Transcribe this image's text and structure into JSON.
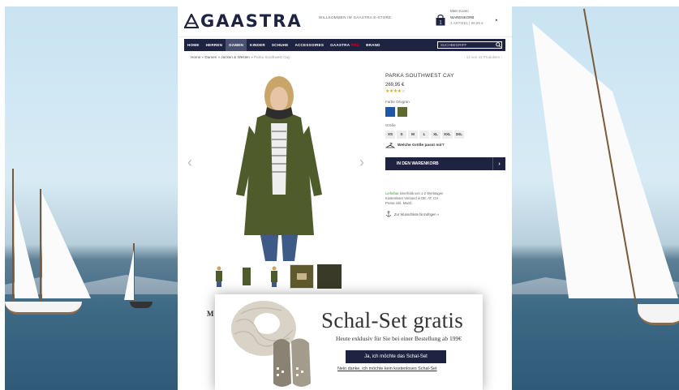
{
  "header": {
    "brand": "GAASTRA",
    "welcome": "WILLKOMMEN IM GAASTRA E-STORE",
    "account": "Mein Konto",
    "cart_title": "WARENKORB",
    "cart_sub": "1 ARTIKEL | 99,95 €"
  },
  "nav": {
    "items": [
      "HOME",
      "HERREN",
      "DAMEN",
      "KINDER",
      "SCHUHE",
      "ACCESSOIRES"
    ],
    "gaastra_pro_prefix": "GAASTRA",
    "gaastra_pro_suffix": "PRO",
    "brand": "BRAND",
    "search_placeholder": "SUCHBEGRIFF"
  },
  "breadcrumb": {
    "parts": [
      "Home",
      "Damen",
      "Jacken & Westen"
    ],
    "current": "Parka Southwest Cay",
    "pager": "12 von 43 Produkten"
  },
  "product": {
    "title": "PARKA SOUTHWEST CAY",
    "price": "269,95 €",
    "rating": 3.5,
    "rating_max": 5,
    "color_label": "Farbe Olivgrün",
    "colors": [
      "#1f56a8",
      "#5e6a2e"
    ],
    "size_label": "Größe",
    "sizes": [
      "XS",
      "S",
      "M",
      "L",
      "XL",
      "XXL",
      "3XL"
    ],
    "fit_link": "Welche Größe passt mir?",
    "add_to_cart": "IN DEN WARENKORB",
    "delivery_green": "Lieferbar",
    "delivery_rest": " innerhalb von 1-2 Werktagen",
    "shipping": "Kostenloser Versand in DE, AT, CH",
    "price_note": "Preise inkl. MwSt.",
    "wishlist": "Zur Wunschliste hinzufügen »"
  },
  "below_label": "M",
  "popup": {
    "title": "Schal-Set gratis",
    "subtitle": "Heute exklusiv für Sie bei einer Bestellung ab 199€",
    "accept": "Ja, ich möchte das Schal-Set",
    "decline": "Nein danke, ich möchte kein kostenloses Schal-Set"
  },
  "colors": {
    "navy": "#1d2340",
    "star": "#e0b000",
    "green": "#3e9a3e",
    "red": "#e2001a"
  }
}
